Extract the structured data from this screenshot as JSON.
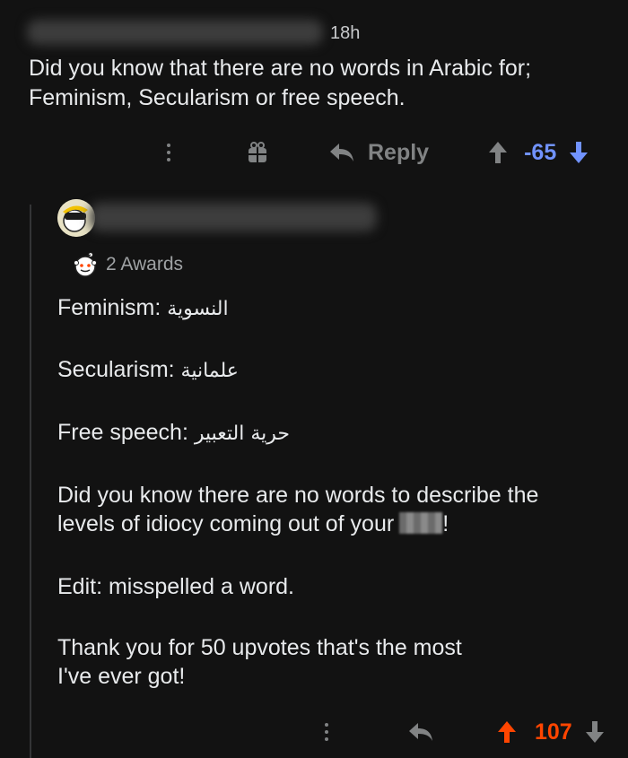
{
  "comment1": {
    "time": "18h",
    "body": "Did you know that there are no words in Arabic for; Feminism, Secularism or free speech.",
    "reply_label": "Reply",
    "score": "-65"
  },
  "comment2": {
    "awards_label": "2 Awards",
    "lines": {
      "feminism_label": "Feminism:",
      "feminism_ar": "النسوية",
      "secularism_label": "Secularism:",
      "secularism_ar": "علمانية",
      "free_speech_label": "Free speech:",
      "free_speech_ar": "حرية التعبير",
      "idiocy": "Did you know there are no words to describe the levels of idiocy coming out of your",
      "idiocy_end": "!",
      "edit": "Edit: misspelled a word.",
      "thanks_1": "Thank you for 50 upvotes that's the most",
      "thanks_2": "I've ever got!"
    },
    "score": "107"
  },
  "colors": {
    "background": "#121212",
    "downvote": "#7193ff",
    "upvote": "#ff4500",
    "icon": "#818384"
  },
  "icons": [
    "more-options-icon",
    "gift-icon",
    "reply-arrow-icon",
    "upvote-arrow-icon",
    "downvote-arrow-icon",
    "award-icon"
  ]
}
